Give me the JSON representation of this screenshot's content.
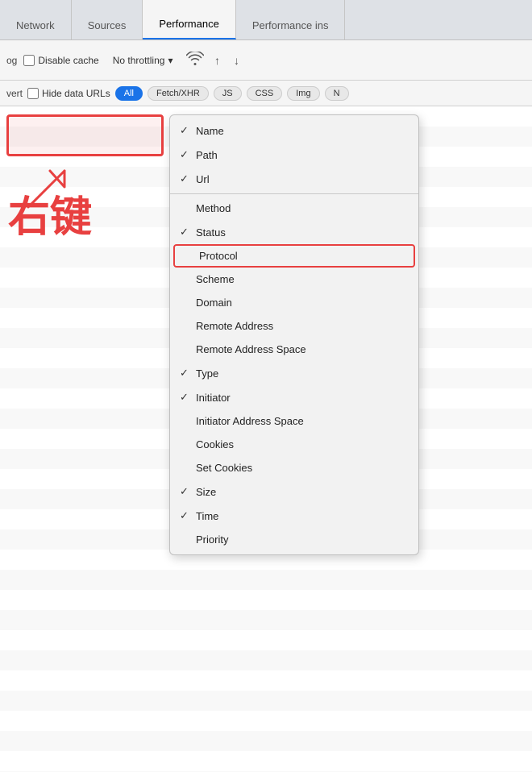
{
  "tabs": [
    {
      "label": "Network",
      "active": true
    },
    {
      "label": "Sources",
      "active": false
    },
    {
      "label": "Performance",
      "active": false
    },
    {
      "label": "Performance ins",
      "active": false
    }
  ],
  "toolbar1": {
    "log_label": "og",
    "disable_cache_label": "Disable cache",
    "throttle_label": "No throttling",
    "wifi_icon": "wifi",
    "upload_icon": "↑",
    "download_icon": "↓"
  },
  "toolbar2": {
    "invert_label": "vert",
    "hide_data_urls_label": "Hide data URLs",
    "filters": [
      {
        "label": "All",
        "active": true
      },
      {
        "label": "Fetch/XHR",
        "active": false
      },
      {
        "label": "JS",
        "active": false
      },
      {
        "label": "CSS",
        "active": false
      },
      {
        "label": "Img",
        "active": false
      },
      {
        "label": "N",
        "active": false
      }
    ]
  },
  "annotation": {
    "arrow": "↗",
    "chinese_text": "右键"
  },
  "context_menu": {
    "items": [
      {
        "label": "Name",
        "checked": true
      },
      {
        "label": "Path",
        "checked": true
      },
      {
        "label": "Url",
        "checked": true
      },
      {
        "separator": true
      },
      {
        "label": "Method",
        "checked": false
      },
      {
        "label": "Status",
        "checked": true
      },
      {
        "label": "Protocol",
        "checked": false,
        "highlighted": true
      },
      {
        "label": "Scheme",
        "checked": false
      },
      {
        "label": "Domain",
        "checked": false
      },
      {
        "label": "Remote Address",
        "checked": false
      },
      {
        "label": "Remote Address Space",
        "checked": false
      },
      {
        "label": "Type",
        "checked": true
      },
      {
        "label": "Initiator",
        "checked": true
      },
      {
        "label": "Initiator Address Space",
        "checked": false
      },
      {
        "label": "Cookies",
        "checked": false
      },
      {
        "label": "Set Cookies",
        "checked": false
      },
      {
        "label": "Size",
        "checked": true
      },
      {
        "label": "Time",
        "checked": true
      },
      {
        "label": "Priority",
        "checked": false,
        "partial": true
      }
    ]
  }
}
